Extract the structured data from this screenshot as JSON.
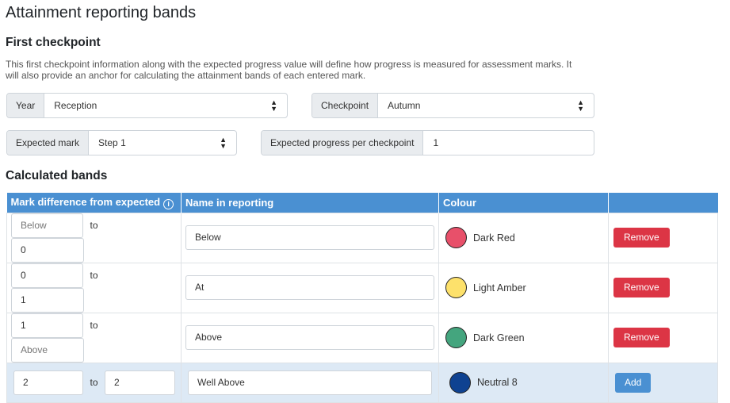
{
  "page": {
    "title": "Attainment reporting bands",
    "first_checkpoint_heading": "First checkpoint",
    "description": "This first checkpoint information along with the expected progress value will define how progress is measured for assessment marks. It will also provide an anchor for calculating the attainment bands of each entered mark.",
    "calculated_bands_heading": "Calculated bands"
  },
  "form": {
    "year": {
      "label": "Year",
      "value": "Reception"
    },
    "checkpoint": {
      "label": "Checkpoint",
      "value": "Autumn"
    },
    "expected_mark": {
      "label": "Expected mark",
      "value": "Step 1"
    },
    "expected_progress": {
      "label": "Expected progress per checkpoint",
      "value": "1"
    }
  },
  "table": {
    "headers": {
      "mark_difference": "Mark difference from expected",
      "name": "Name in reporting",
      "colour": "Colour",
      "action": ""
    },
    "to_label": "to",
    "rows": [
      {
        "from": "Below",
        "from_placeholder": true,
        "to": "0",
        "to_placeholder": false,
        "name": "Below",
        "colour_name": "Dark Red",
        "colour_hex": "#e8506a",
        "action": "Remove"
      },
      {
        "from": "0",
        "from_placeholder": false,
        "to": "1",
        "to_placeholder": false,
        "name": "At",
        "colour_name": "Light Amber",
        "colour_hex": "#fde16b",
        "action": "Remove"
      },
      {
        "from": "1",
        "from_placeholder": false,
        "to": "Above",
        "to_placeholder": true,
        "name": "Above",
        "colour_name": "Dark Green",
        "colour_hex": "#44a57e",
        "action": "Remove"
      }
    ],
    "new_row": {
      "from": "2",
      "to": "2",
      "name": "Well Above",
      "colour_name": "Neutral 8",
      "colour_hex": "#0f4291",
      "action": "Add"
    }
  },
  "colors": {
    "header_blue": "#4a90d2",
    "remove_red": "#dc3545",
    "add_row_bg": "#dde9f5"
  },
  "icons": {
    "info": "info-icon",
    "select_caret": "chevron-updown-icon"
  }
}
